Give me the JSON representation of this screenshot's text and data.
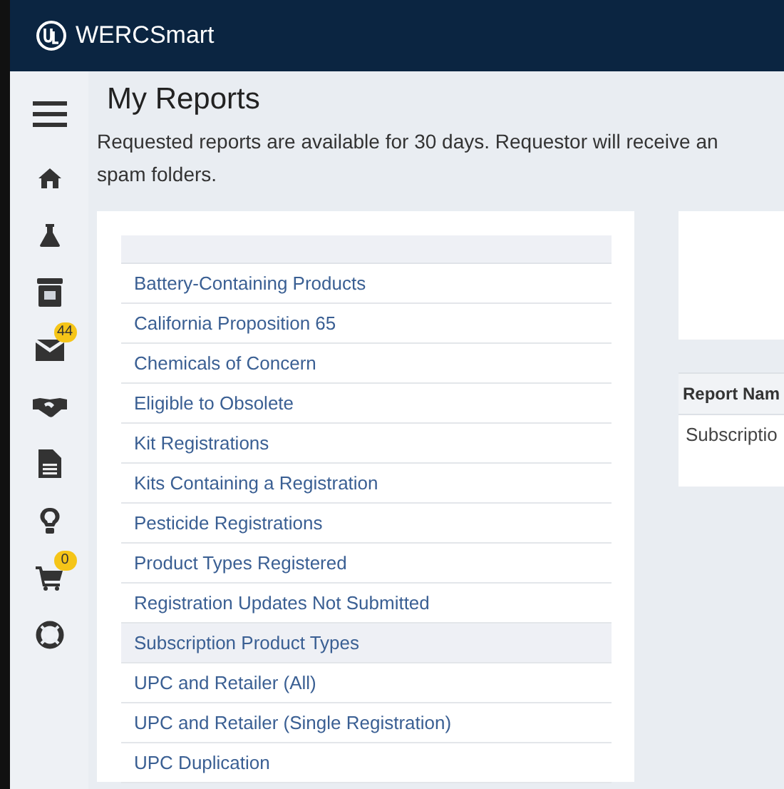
{
  "app": {
    "name": "WERCSmart"
  },
  "sidebar": {
    "items": [
      {
        "kind": "menu"
      },
      {
        "kind": "home"
      },
      {
        "kind": "flask"
      },
      {
        "kind": "archive"
      },
      {
        "kind": "mail",
        "badge": "44"
      },
      {
        "kind": "handshake"
      },
      {
        "kind": "document"
      },
      {
        "kind": "bulb"
      },
      {
        "kind": "cart",
        "badge": "0"
      },
      {
        "kind": "lifebuoy"
      }
    ]
  },
  "page": {
    "title": "My Reports",
    "description": [
      "Requested reports are available for 30 days. Requestor will receive an",
      "spam folders."
    ]
  },
  "report_list": {
    "items": [
      {
        "label": "Battery-Containing Products",
        "selected": false
      },
      {
        "label": "California Proposition 65",
        "selected": false
      },
      {
        "label": "Chemicals of Concern",
        "selected": false
      },
      {
        "label": "Eligible to Obsolete",
        "selected": false
      },
      {
        "label": "Kit Registrations",
        "selected": false
      },
      {
        "label": "Kits Containing a Registration",
        "selected": false
      },
      {
        "label": "Pesticide Registrations",
        "selected": false
      },
      {
        "label": "Product Types Registered",
        "selected": false
      },
      {
        "label": "Registration Updates Not Submitted",
        "selected": false
      },
      {
        "label": "Subscription Product Types",
        "selected": true
      },
      {
        "label": "UPC and Retailer (All)",
        "selected": false
      },
      {
        "label": "UPC and Retailer (Single Registration)",
        "selected": false
      },
      {
        "label": "UPC Duplication",
        "selected": false
      }
    ]
  },
  "requests_table": {
    "columns": [
      "Report Nam"
    ],
    "rows": [
      [
        "Subscriptio"
      ]
    ]
  }
}
